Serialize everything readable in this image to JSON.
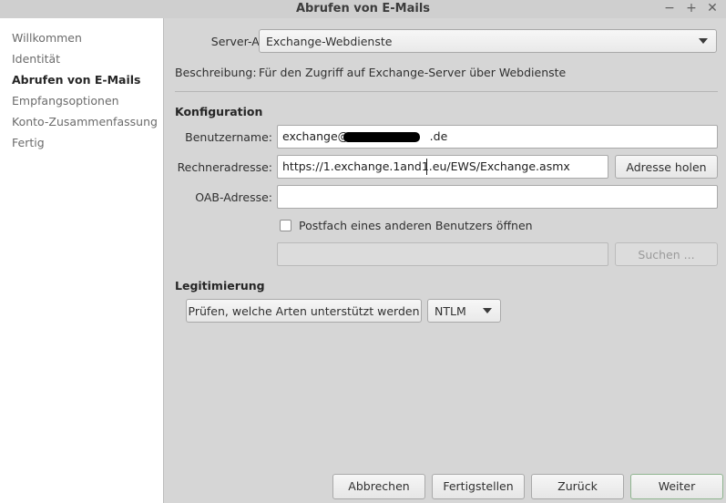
{
  "window": {
    "title": "Abrufen von E-Mails",
    "controls": {
      "minimize": "−",
      "maximize": "+",
      "close": "✕"
    }
  },
  "sidebar": {
    "items": [
      {
        "label": "Willkommen",
        "active": false
      },
      {
        "label": "Identität",
        "active": false
      },
      {
        "label": "Abrufen von E-Mails",
        "active": true
      },
      {
        "label": "Empfangsoptionen",
        "active": false
      },
      {
        "label": "Konto-Zusammenfassung",
        "active": false
      },
      {
        "label": "Fertig",
        "active": false
      }
    ]
  },
  "main": {
    "server_type": {
      "label": "Server-Art:",
      "value": "Exchange-Webdienste"
    },
    "description": {
      "label": "Beschreibung:",
      "value": "Für den Zugriff auf Exchange-Server über Webdienste"
    },
    "config": {
      "heading": "Konfiguration",
      "username": {
        "label": "Benutzername:",
        "value_prefix": "exchange@s",
        "value_suffix": ".de"
      },
      "host": {
        "label": "Rechneradresse:",
        "value": "https://1.exchange.1and1.eu/EWS/Exchange.asmx"
      },
      "fetch_address_button": "Adresse holen",
      "oab": {
        "label": "OAB-Adresse:",
        "value": ""
      },
      "other_mailbox_checkbox": {
        "label": "Postfach eines anderen Benutzers öffnen",
        "checked": false
      },
      "mailbox_field": {
        "value": ""
      },
      "search_button": "Suchen ..."
    },
    "auth": {
      "heading": "Legitimierung",
      "check_button": "Prüfen, welche Arten unterstützt werden",
      "method": "NTLM"
    }
  },
  "footer": {
    "cancel": "Abbrechen",
    "finish": "Fertigstellen",
    "back": "Zurück",
    "next": "Weiter"
  },
  "colors": {
    "window_bg": "#d6d6d6",
    "sidebar_bg": "#ffffff",
    "default_button_border": "#8fb58f"
  }
}
